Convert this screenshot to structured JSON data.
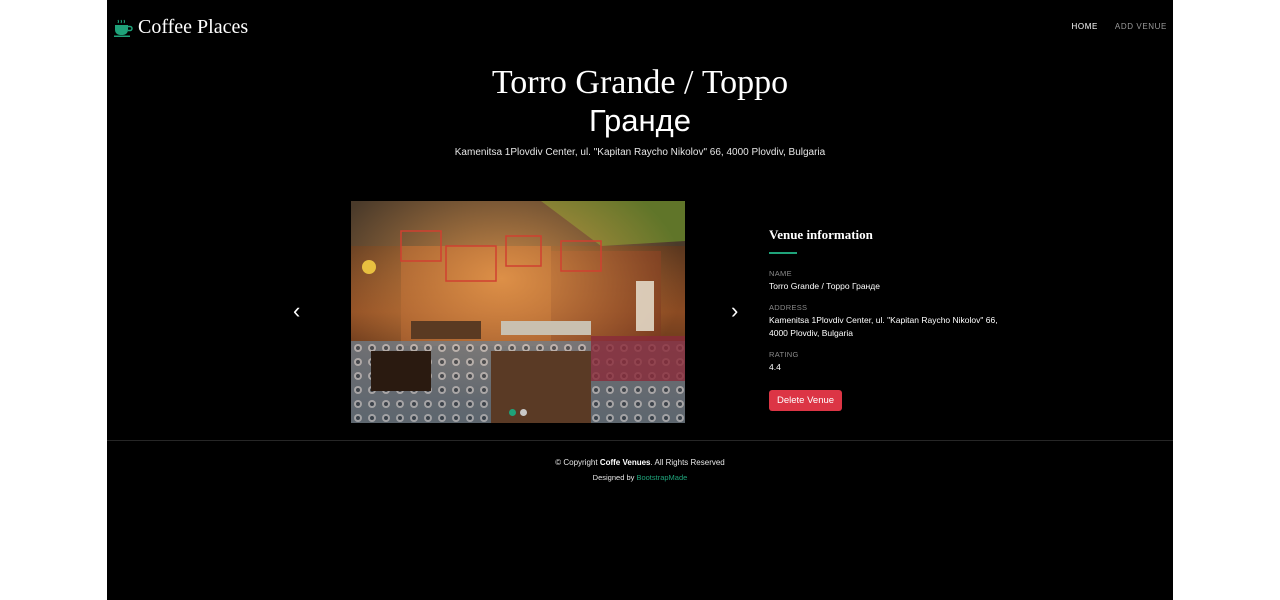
{
  "brand": {
    "name": "Coffee Places",
    "icon": "coffee-cup-icon",
    "accent_color": "#1fa37a"
  },
  "nav": {
    "items": [
      {
        "label": "HOME"
      },
      {
        "label": "ADD VENUE"
      }
    ]
  },
  "hero": {
    "title_line1": "Torro Grande / Торро",
    "title_line2": "Гранде",
    "subtitle": "Kamenitsa 1Plovdiv Center, ul. \"Kapitan Raycho Nikolov\" 66, 4000 Plovdiv, Bulgaria"
  },
  "carousel": {
    "prev_icon": "chevron-left-icon",
    "next_icon": "chevron-right-icon",
    "slide_count": 2,
    "active_index": 0
  },
  "venue_info": {
    "heading": "Venue information",
    "name_label": "NAME",
    "name_value": "Torro Grande / Торро Гранде",
    "address_label": "ADDRESS",
    "address_value": "Kamenitsa 1Plovdiv Center, ul. \"Kapitan Raycho Nikolov\" 66, 4000 Plovdiv, Bulgaria",
    "rating_label": "RATING",
    "rating_value": "4.4",
    "delete_label": "Delete Venue",
    "delete_color": "#dc3545"
  },
  "footer": {
    "copyright_prefix": "© Copyright ",
    "copyright_brand": "Coffe Venues",
    "copyright_suffix": ". All Rights Reserved",
    "designed_prefix": "Designed by ",
    "designed_link": "BootstrapMade"
  }
}
